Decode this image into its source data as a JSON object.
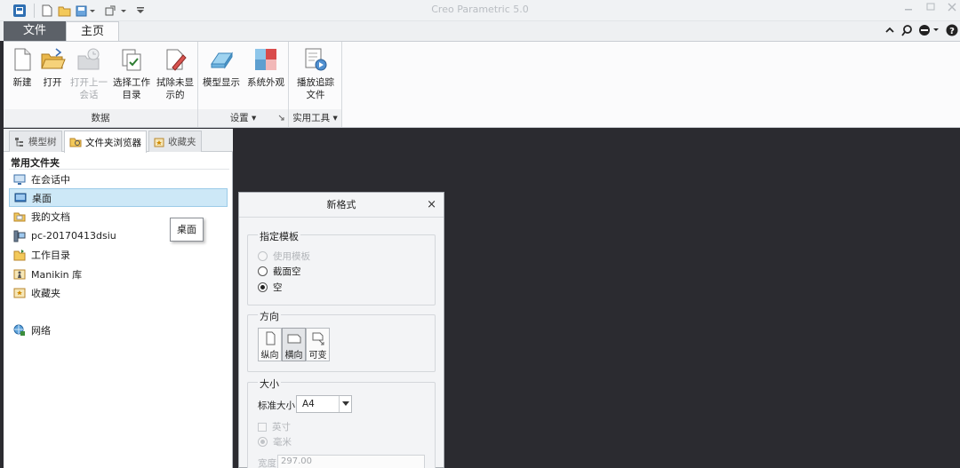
{
  "window": {
    "app_title": "Creo Parametric 5.0",
    "help_icon": "?",
    "colors": {
      "file_tab": "#5c6168",
      "canvas": "#2b2b30",
      "selection": "#cde8f7"
    }
  },
  "tabs": {
    "file": "文件",
    "home": "主页"
  },
  "ribbon": {
    "new": "新建",
    "open": "打开",
    "open_last_line1": "打开上一",
    "open_last_line2": "会话",
    "select_dir_line1": "选择工作",
    "select_dir_line2": "目录",
    "erase_line1": "拭除未显",
    "erase_line2": "示的",
    "model_display": "模型显示",
    "system_appearance": "系统外观",
    "playback_line1": "播放追踪",
    "playback_line2": "文件",
    "group_data": "数据",
    "group_settings": "设置 ▾",
    "group_utilities": "实用工具 ▾"
  },
  "navigator": {
    "tabs": {
      "model_tree": "模型树",
      "folder_browser": "文件夹浏览器",
      "favorites": "收藏夹"
    },
    "common_folders": "常用文件夹",
    "items": [
      {
        "label": "在会话中",
        "icon": "session-icon"
      },
      {
        "label": "桌面",
        "icon": "desktop-icon"
      },
      {
        "label": "我的文档",
        "icon": "documents-icon"
      },
      {
        "label": "pc-20170413dsiu",
        "icon": "computer-icon"
      },
      {
        "label": "工作目录",
        "icon": "work-folder-icon"
      },
      {
        "label": "Manikin 库",
        "icon": "library-icon"
      },
      {
        "label": "收藏夹",
        "icon": "favorites-icon"
      }
    ],
    "network": "网络",
    "tooltip": "桌面"
  },
  "dialog": {
    "title": "新格式",
    "close": "×",
    "template_group": "指定模板",
    "use_template": "使用模板",
    "empty_with_section": "截面空",
    "empty": "空",
    "orientation_group": "方向",
    "portrait": "纵向",
    "landscape": "横向",
    "variable": "可变",
    "size_group": "大小",
    "standard_size_label": "标准大小",
    "standard_size_value": "A4",
    "inches": "英寸",
    "millimeters": "毫米",
    "width_label": "宽度",
    "width_value": "297.00"
  }
}
